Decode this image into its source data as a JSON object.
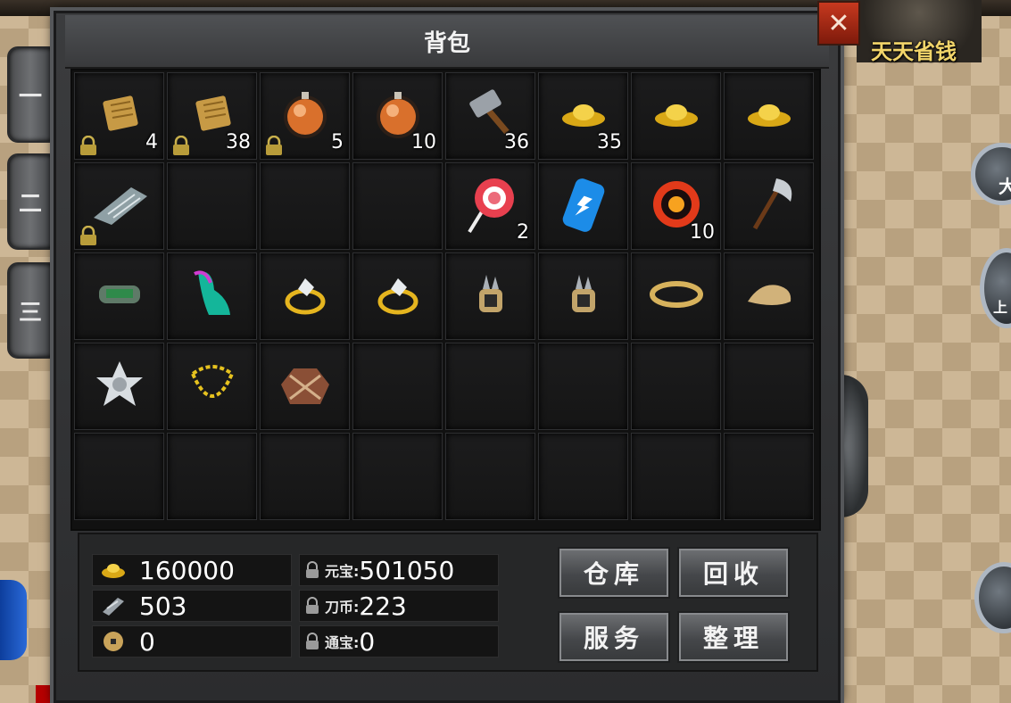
{
  "shop_label": "天天省钱",
  "side_tabs": [
    "一",
    "二",
    "三"
  ],
  "bag": {
    "title": "背包",
    "close": "✕",
    "slots": [
      {
        "icon": "scroll-icon",
        "count": "4",
        "locked": true
      },
      {
        "icon": "scroll-icon",
        "count": "38",
        "locked": true
      },
      {
        "icon": "orange-potion-icon",
        "count": "5",
        "locked": true
      },
      {
        "icon": "orange-potion-icon",
        "count": "10",
        "locked": false
      },
      {
        "icon": "hammer-icon",
        "count": "36",
        "locked": false
      },
      {
        "icon": "gold-ingot-icon",
        "count": "35",
        "locked": false
      },
      {
        "icon": "gold-ingot-icon",
        "count": "",
        "locked": false
      },
      {
        "icon": "gold-ingot-icon",
        "count": "",
        "locked": false
      },
      {
        "icon": "stone-tablet-icon",
        "count": "",
        "locked": true
      },
      {
        "icon": "",
        "count": "",
        "locked": false
      },
      {
        "icon": "",
        "count": "",
        "locked": false
      },
      {
        "icon": "",
        "count": "",
        "locked": false
      },
      {
        "icon": "lollipop-icon",
        "count": "2",
        "locked": false
      },
      {
        "icon": "energy-battery-icon",
        "count": "",
        "locked": false
      },
      {
        "icon": "fire-orb-icon",
        "count": "10",
        "locked": false
      },
      {
        "icon": "battle-axe-icon",
        "count": "",
        "locked": false
      },
      {
        "icon": "bracer-icon",
        "count": "",
        "locked": false
      },
      {
        "icon": "magic-boots-icon",
        "count": "",
        "locked": false
      },
      {
        "icon": "gold-ring-icon",
        "count": "",
        "locked": false
      },
      {
        "icon": "gold-ring-icon",
        "count": "",
        "locked": false
      },
      {
        "icon": "spiked-ring-icon",
        "count": "",
        "locked": false
      },
      {
        "icon": "spiked-ring-icon",
        "count": "",
        "locked": false
      },
      {
        "icon": "bracelet-icon",
        "count": "",
        "locked": false
      },
      {
        "icon": "gauntlet-icon",
        "count": "",
        "locked": false
      },
      {
        "icon": "silver-medal-icon",
        "count": "",
        "locked": false
      },
      {
        "icon": "gold-necklace-icon",
        "count": "",
        "locked": false
      },
      {
        "icon": "armor-icon",
        "count": "",
        "locked": false
      },
      {
        "icon": "",
        "count": "",
        "locked": false
      },
      {
        "icon": "",
        "count": "",
        "locked": false
      },
      {
        "icon": "",
        "count": "",
        "locked": false
      },
      {
        "icon": "",
        "count": "",
        "locked": false
      },
      {
        "icon": "",
        "count": "",
        "locked": false
      },
      {
        "icon": "",
        "count": "",
        "locked": false
      },
      {
        "icon": "",
        "count": "",
        "locked": false
      },
      {
        "icon": "",
        "count": "",
        "locked": false
      },
      {
        "icon": "",
        "count": "",
        "locked": false
      },
      {
        "icon": "",
        "count": "",
        "locked": false
      },
      {
        "icon": "",
        "count": "",
        "locked": false
      },
      {
        "icon": "",
        "count": "",
        "locked": false
      },
      {
        "icon": "",
        "count": "",
        "locked": false
      }
    ]
  },
  "currency": {
    "gold": "160000",
    "silver": "503",
    "coin": "0",
    "yuanbao_label": "元宝:",
    "yuanbao": "501050",
    "daobi_label": "刀币:",
    "daobi": "223",
    "tongbao_label": "通宝:",
    "tongbao": "0"
  },
  "buttons": {
    "warehouse": "仓库",
    "recycle": "回收",
    "service": "服务",
    "arrange": "整理"
  },
  "right_orbs": [
    "大",
    "上"
  ],
  "colors": {
    "gold": "#f2d56a",
    "close": "#c6391f",
    "banner": "#b60000"
  }
}
